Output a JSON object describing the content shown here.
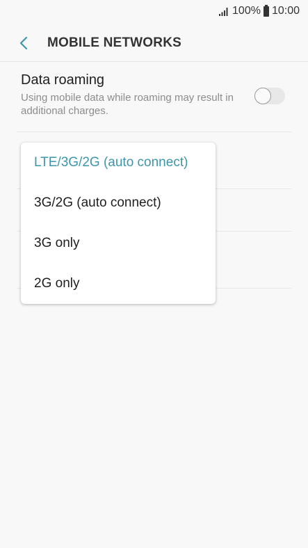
{
  "status_bar": {
    "battery_percent": "100%",
    "time": "10:00",
    "icons": [
      "signal-icon",
      "battery-icon"
    ]
  },
  "header": {
    "title": "MOBILE NETWORKS",
    "back_icon": "chevron-left-icon"
  },
  "data_roaming": {
    "title": "Data roaming",
    "description": "Using mobile data while roaming may result in additional charges.",
    "enabled": false
  },
  "network_mode_dropdown": {
    "selected": "LTE/3G/2G (auto connect)",
    "options": [
      {
        "label": "LTE/3G/2G (auto connect)",
        "selected": true
      },
      {
        "label": "3G/2G (auto connect)",
        "selected": false
      },
      {
        "label": "3G only",
        "selected": false
      },
      {
        "label": "2G only",
        "selected": false
      }
    ]
  },
  "colors": {
    "accent": "#3e96ac",
    "background": "#f8f8f8",
    "text_primary": "#1e1e1e",
    "text_secondary": "#8c8c8c"
  }
}
